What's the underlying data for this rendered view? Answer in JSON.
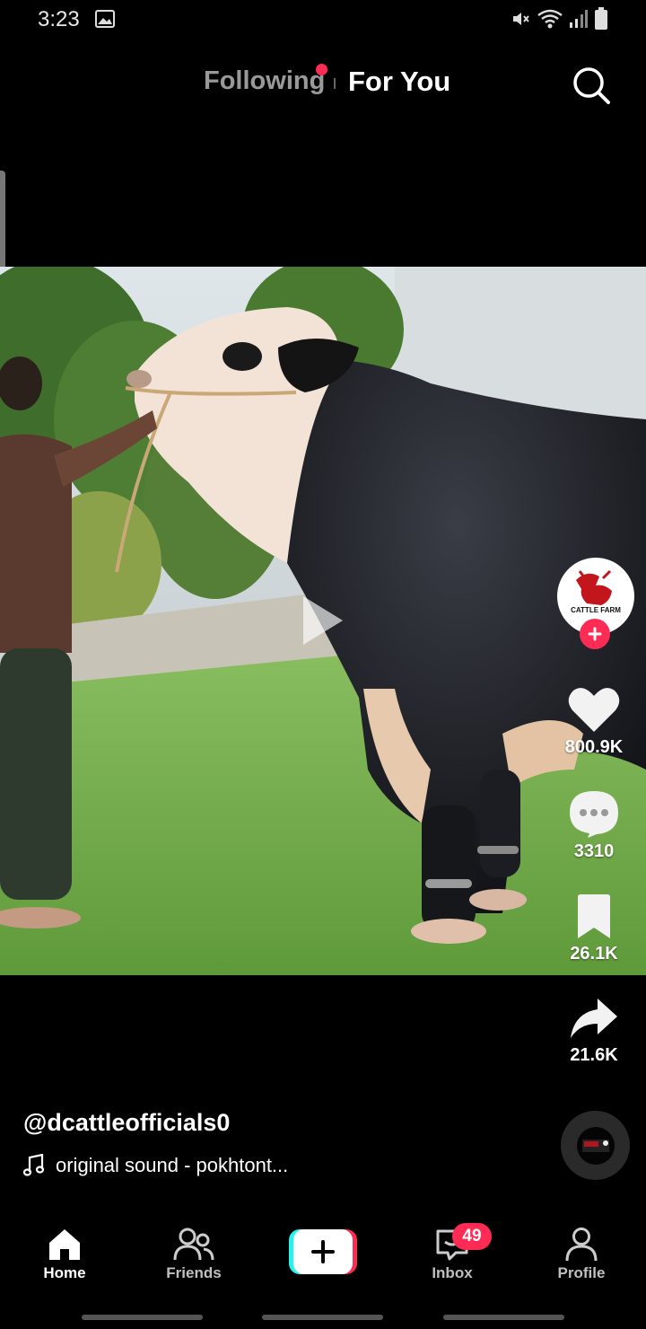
{
  "status_bar": {
    "time": "3:23",
    "icons": [
      "gallery-icon",
      "mute-icon",
      "wifi-icon",
      "signal-icon",
      "battery-icon"
    ]
  },
  "top_nav": {
    "tabs": [
      {
        "label": "Following",
        "active": false,
        "has_dot": true
      },
      {
        "label": "For You",
        "active": true
      }
    ],
    "search_icon": "search-icon"
  },
  "video": {
    "play_icon": "play-icon"
  },
  "creator": {
    "avatar_icon": "cattle-farm-logo",
    "avatar_text": "CATTLE FARM",
    "follow_icon": "plus-icon"
  },
  "actions": {
    "likes": "800.9K",
    "comments": "3310",
    "saves": "26.1K",
    "shares": "21.6K"
  },
  "caption": {
    "username": "@dcattleofficials0",
    "sound": "original sound - pokhtont..."
  },
  "bottom_nav": {
    "items": [
      {
        "label": "Home",
        "icon": "home-icon",
        "active": true
      },
      {
        "label": "Friends",
        "icon": "friends-icon",
        "active": false
      },
      {
        "label": "",
        "icon": "create-icon",
        "active": false
      },
      {
        "label": "Inbox",
        "icon": "inbox-icon",
        "active": false,
        "badge": "49"
      },
      {
        "label": "Profile",
        "icon": "profile-icon",
        "active": false
      }
    ]
  },
  "colors": {
    "accent": "#fe2c55",
    "background": "#000000",
    "create_cyan": "#25f4ee"
  }
}
